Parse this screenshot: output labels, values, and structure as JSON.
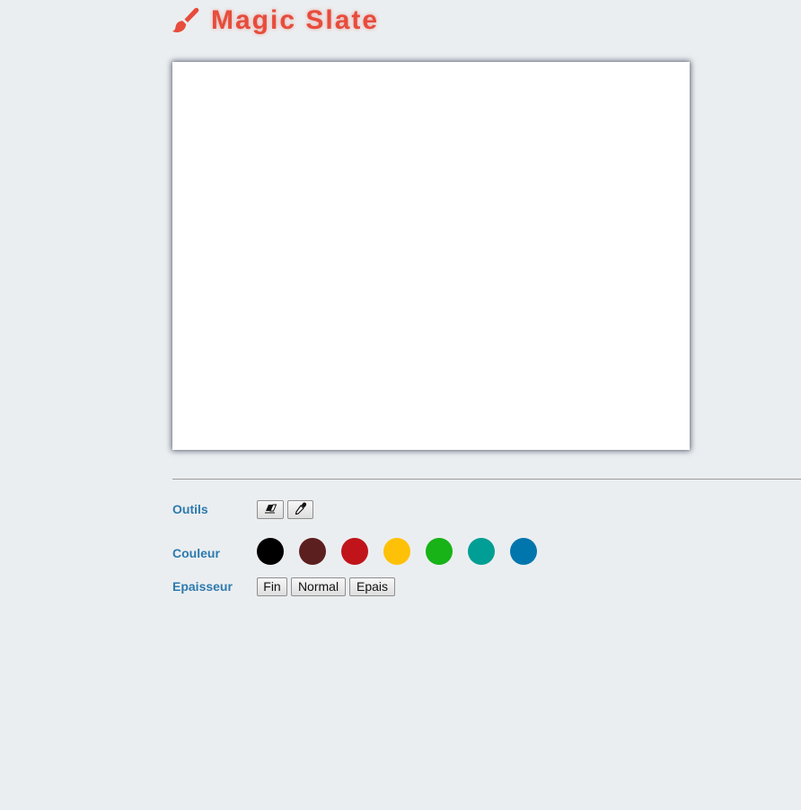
{
  "app": {
    "title": "Magic Slate",
    "accent_color": "#e74c3c",
    "logo_icon": "paintbrush-icon"
  },
  "toolbar": {
    "tools_label": "Outils",
    "tools": [
      {
        "name": "eraser",
        "icon": "eraser-icon"
      },
      {
        "name": "eyedropper",
        "icon": "eyedropper-icon"
      }
    ],
    "color_label": "Couleur",
    "colors": [
      "#000000",
      "#5c1f1f",
      "#c0141a",
      "#ffc107",
      "#17b317",
      "#009e94",
      "#0076ad"
    ],
    "thickness_label": "Epaisseur",
    "thickness": {
      "fine": "Fin",
      "normal": "Normal",
      "thick": "Epais"
    }
  }
}
